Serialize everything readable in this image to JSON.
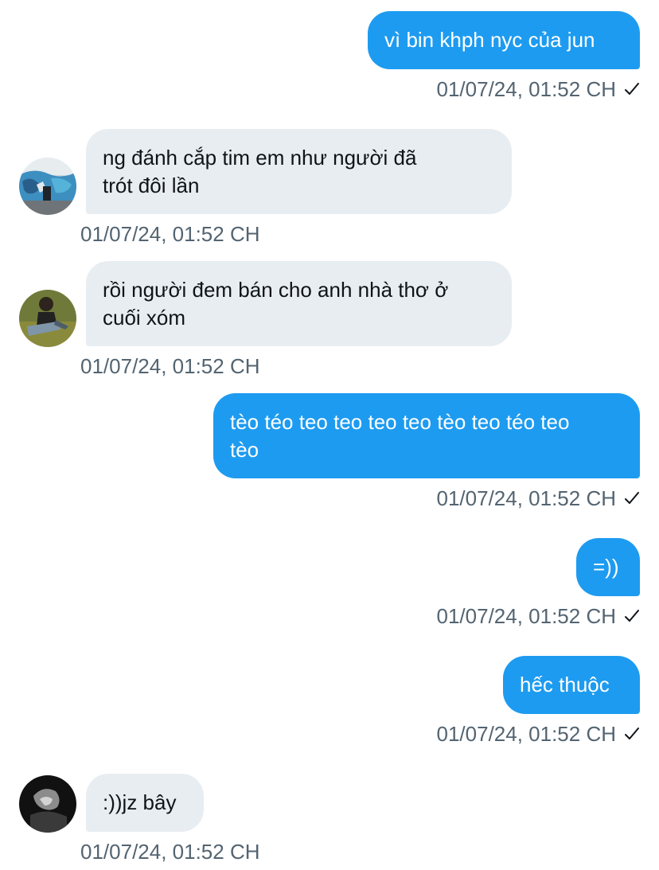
{
  "messages": [
    {
      "direction": "outgoing",
      "text": "vì bin khph nyc của jun",
      "time": "01/07/24, 01:52 CH",
      "status_icon": "check-icon"
    },
    {
      "direction": "incoming",
      "text": "ng đánh cắp tim em như người đã\ntrót đôi lần",
      "time": "01/07/24, 01:52 CH",
      "avatar_icon": "graffiti-photo-avatar"
    },
    {
      "direction": "incoming",
      "text": "rồi người đem bán cho anh nhà thơ ở\ncuối xóm",
      "time": "01/07/24, 01:52 CH",
      "avatar_icon": "person-on-grass-avatar"
    },
    {
      "direction": "outgoing",
      "text": "tèo téo teo teo teo teo tèo teo téo teo\ntèo",
      "time": "01/07/24, 01:52 CH",
      "status_icon": "check-icon"
    },
    {
      "direction": "outgoing",
      "text": "=))",
      "time": "01/07/24, 01:52 CH",
      "status_icon": "check-icon"
    },
    {
      "direction": "outgoing",
      "text": "hếc thuộc",
      "time": "01/07/24, 01:52 CH",
      "status_icon": "check-icon"
    },
    {
      "direction": "incoming",
      "text": ":))jz bây",
      "time": "01/07/24, 01:52 CH",
      "avatar_icon": "dark-portrait-avatar"
    }
  ],
  "colors": {
    "outgoing_bubble": "#1d9bf0",
    "incoming_bubble": "#e8edf1",
    "timestamp": "#536471"
  }
}
